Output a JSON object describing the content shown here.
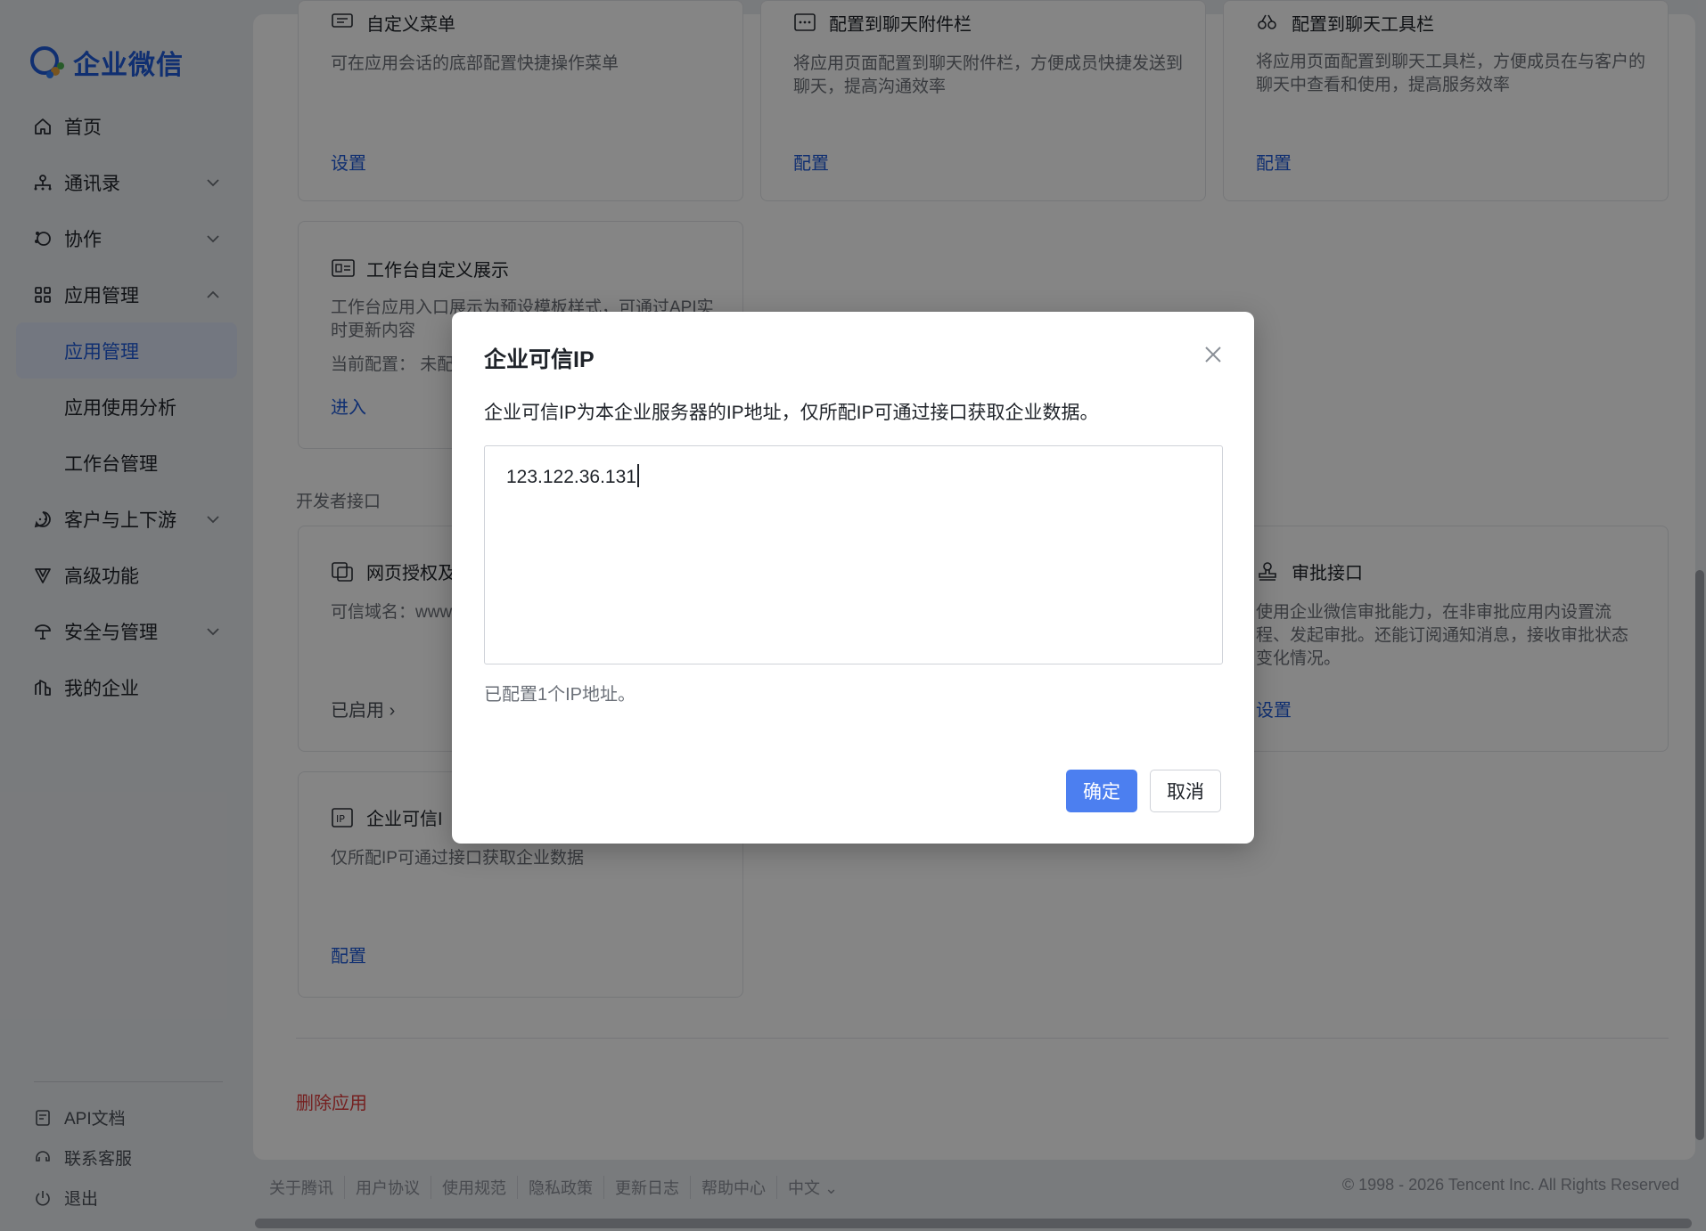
{
  "app": {
    "logo_text": "企业微信"
  },
  "sidebar": {
    "items": [
      {
        "label": "首页",
        "icon": "home-icon"
      },
      {
        "label": "通讯录",
        "icon": "contacts-icon"
      },
      {
        "label": "协作",
        "icon": "collab-icon"
      },
      {
        "label": "应用管理",
        "icon": "apps-icon"
      },
      {
        "label": "应用管理",
        "icon": ""
      },
      {
        "label": "应用使用分析",
        "icon": ""
      },
      {
        "label": "工作台管理",
        "icon": ""
      },
      {
        "label": "客户与上下游",
        "icon": "customer-icon"
      },
      {
        "label": "高级功能",
        "icon": "advanced-icon"
      },
      {
        "label": "安全与管理",
        "icon": "security-icon"
      },
      {
        "label": "我的企业",
        "icon": "company-icon"
      }
    ],
    "bottom": [
      {
        "label": "API文档",
        "icon": "api-doc-icon"
      },
      {
        "label": "联系客服",
        "icon": "support-icon"
      },
      {
        "label": "退出",
        "icon": "logout-icon"
      }
    ]
  },
  "cards": {
    "custom_menu": {
      "title": "自定义菜单",
      "desc": "可在应用会话的底部配置快捷操作菜单",
      "link": "设置"
    },
    "chat_attachment": {
      "title": "配置到聊天附件栏",
      "desc": "将应用页面配置到聊天附件栏，方便成员快捷发送到聊天，提高沟通效率",
      "link": "配置"
    },
    "chat_toolbar": {
      "title": "配置到聊天工具栏",
      "desc": "将应用页面配置到聊天工具栏，方便成员在与客户的聊天中查看和使用，提高服务效率",
      "link": "配置"
    },
    "workbench": {
      "title": "工作台自定义展示",
      "desc": "工作台应用入口展示为预设模板样式，可通过API实时更新内容",
      "config_prefix": "当前配置：",
      "config_value": "未配",
      "link": "进入"
    },
    "web_auth": {
      "title": "网页授权及",
      "desc": "可信域名：www",
      "link": "已启用"
    },
    "approval": {
      "title": "审批接口",
      "desc": "使用企业微信审批能力，在非审批应用内设置流程、发起审批。还能订阅通知消息，接收审批状态变化情况。",
      "link": "设置"
    },
    "trusted_ip": {
      "title": "企业可信I",
      "desc": "仅所配IP可通过接口获取企业数据",
      "link": "配置"
    }
  },
  "section_label": "开发者接口",
  "delete_app": "删除应用",
  "footer": {
    "links": [
      "关于腾讯",
      "用户协议",
      "使用规范",
      "隐私政策",
      "更新日志",
      "帮助中心",
      "中文"
    ],
    "copyright": "© 1998 - 2026 Tencent Inc. All Rights Reserved"
  },
  "dialog": {
    "title": "企业可信IP",
    "description": "企业可信IP为本企业服务器的IP地址，仅所配IP可通过接口获取企业数据。",
    "textarea_value": "123.122.36.131",
    "count_text": "已配置1个IP地址。",
    "ok_label": "确定",
    "cancel_label": "取消"
  },
  "colors": {
    "accent": "#4c7ff0",
    "link": "#1f5bd8",
    "danger": "#e03e3e"
  }
}
